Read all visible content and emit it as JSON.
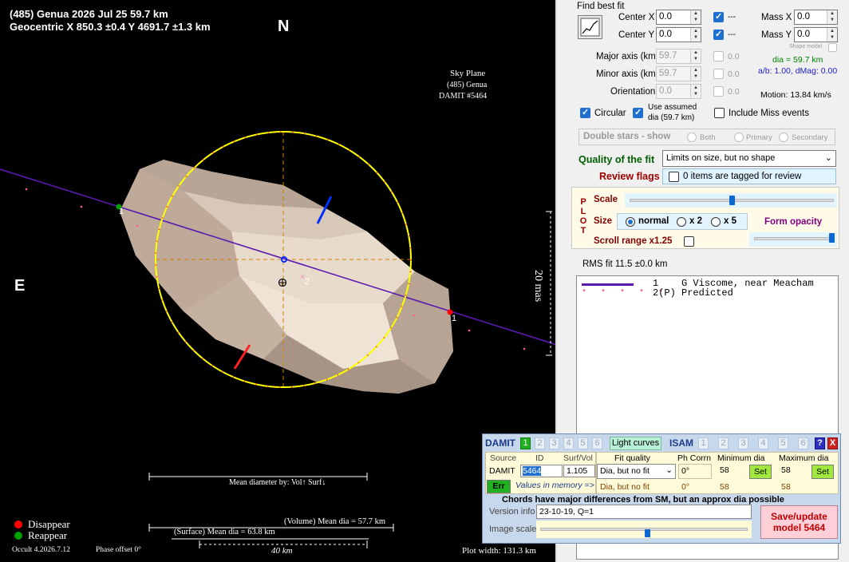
{
  "plot": {
    "title_line1": "(485) Genua  2026 Jul 25   59.7 km",
    "title_line2": "Geocentric  X  850.3 ±0.4  Y 4691.7 ±1.3 km",
    "north": "N",
    "east": "E",
    "skyplane": [
      "Sky Plane",
      "(485) Genua",
      "DAMIT #5464"
    ],
    "scale_label": "20 mas",
    "chord1_label_left": "1",
    "chord1_label_right": "1",
    "chord2_label": "2",
    "mean_dia_title": "Mean diameter by: Vol↑ Surf↓",
    "vol_dia": "(Volume) Mean dia = 57.7 km",
    "surf_dia": "(Surface) Mean dia = 63.8 km",
    "scale_km": "40 km",
    "legend_disappear": "Disappear",
    "legend_reappear": "Reappear",
    "version": "Occult 4.2026.7.12",
    "phase_offset": "Phase offset 0°",
    "plot_width": "Plot width: 131.3 km",
    "colors": {
      "disappear": "#ff0000",
      "reappear": "#00a000",
      "ellipse": "#ffff00",
      "chord": "#5a1ab0"
    }
  },
  "panel": {
    "find_best_fit": "Find best fit",
    "fit_icon": "chart-fit-icon",
    "center_x_label": "Center X",
    "center_x": "0.0",
    "center_y_label": "Center Y",
    "center_y": "0.0",
    "dash1": "---",
    "dash2": "---",
    "mass_x_label": "Mass X",
    "mass_x": "0.0",
    "mass_y_label": "Mass Y",
    "mass_y": "0.0",
    "shape_model": "Shape model",
    "major_label": "Major axis (km)",
    "major": "59.7",
    "minor_label": "Minor axis (km)",
    "minor": "59.7",
    "orient_label": "Orientation",
    "orient": "0.0",
    "zero1": "0.0",
    "zero2": "0.0",
    "zero3": "0.0",
    "dia": "dia = 59.7 km",
    "ab": "a/b: 1.00, dMag: 0.00",
    "motion": "Motion: 13.84 km/s",
    "circular": "Circular",
    "use_assumed": "Use assumed",
    "use_assumed_dia": "dia (59.7 km)",
    "include_miss": "Include Miss events",
    "double_stars": "Double stars - show",
    "both": "Both",
    "primary": "Primary",
    "secondary": "Secondary",
    "quality_label": "Quality of the fit",
    "quality_value": "Limits on size, but no shape",
    "review_label": "Review flags",
    "review_value": "0 items are tagged for review",
    "plot_letters": [
      "P",
      "L",
      "O",
      "T"
    ],
    "scale_label": "Scale",
    "size_label": "Size",
    "size_normal": "normal",
    "size_x2": "x 2",
    "size_x5": "x 5",
    "form_opacity": "Form opacity",
    "scroll_range": "Scroll range x1.25",
    "rms": "RMS fit 11.5 ±0.0 km",
    "results": [
      {
        "num": "1",
        "name": "G Viscome, near Meacham"
      },
      {
        "num": "2(P)",
        "name": "Predicted"
      }
    ]
  },
  "damit": {
    "title": "DAMIT",
    "tabs": [
      "1",
      "2",
      "3",
      "4",
      "5",
      "6"
    ],
    "light_curves": "Light curves",
    "isam": "ISAM",
    "isam_tabs": [
      "1",
      "2",
      "3",
      "4",
      "5",
      "6"
    ],
    "help": "?",
    "close": "X",
    "source_hdr": "Source",
    "id_hdr": "ID",
    "surfvol_hdr": "Surf/Vol",
    "source": "DAMIT",
    "id": "5464",
    "surfvol": "1.105",
    "err": "Err",
    "values_in_memory": "Values in memory =>",
    "fit_quality_hdr": "Fit quality",
    "phcorr_hdr": "Ph Corrn",
    "min_dia_hdr": "Minimum dia",
    "max_dia_hdr": "Maximum dia",
    "fit_quality": "Dia, but no fit",
    "phcorr": "0°",
    "min_dia": "58",
    "max_dia": "58",
    "set": "Set",
    "mem_fit_quality": "Dia, but no fit",
    "mem_phcorr": "0°",
    "mem_min": "58",
    "mem_max": "58",
    "warning": "Chords have major differences from SM, but an approx dia possible",
    "version_label": "Version info",
    "version_value": "23-10-19, Q=1",
    "image_scale": "Image scale",
    "save": "Save/update",
    "save_model": "model 5464"
  }
}
